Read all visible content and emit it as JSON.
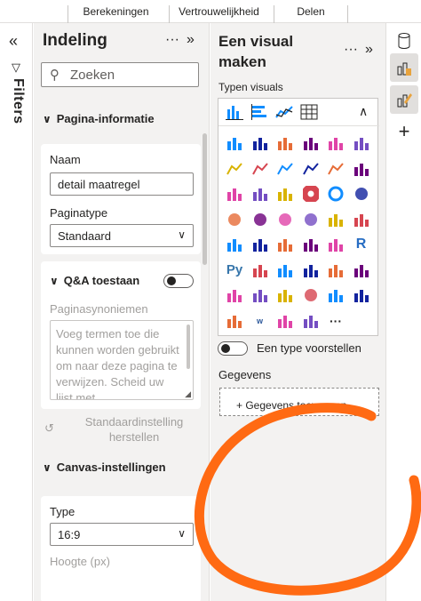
{
  "ribbon": {
    "tabs": [
      "Berekeningen",
      "Vertrouwelijkheid",
      "Delen"
    ]
  },
  "filters_pane": {
    "label": "Filters",
    "expand_icon": "chevron-double-left-icon",
    "filter_icon": "funnel-icon"
  },
  "format_pane": {
    "title": "Indeling",
    "more": "···",
    "search_placeholder": "Zoeken",
    "pagina_section": "Pagina-informatie",
    "name_label": "Naam",
    "name_value": "detail maatregel",
    "pagetype_label": "Paginatype",
    "pagetype_value": "Standaard",
    "qa_title": "Q&A toestaan",
    "synonyms_label": "Paginasynoniemen",
    "synonyms_placeholder": "Voeg termen toe die kunnen worden gebruikt om naar deze pagina te verwijzen. Scheid uw lijst met",
    "reset_label": "Standaardinstelling herstellen",
    "canvas_section": "Canvas-instellingen",
    "type_label": "Type",
    "type_value": "16:9",
    "height_label": "Hoogte (px)"
  },
  "viz_pane": {
    "title": "Een visual maken",
    "more": "···",
    "subtitle": "Typen visuals",
    "suggest_label": "Een type voorstellen",
    "data_label": "Gegevens",
    "add_data_label": "+ Gegevens toevoegen",
    "more_visuals": "···",
    "visual_icons": [
      "stacked-bar-chart-icon",
      "clustered-bar-chart-icon",
      "stacked-column-chart-icon",
      "clustered-column-chart-icon",
      "100-stacked-bar-icon",
      "100-stacked-column-icon",
      "line-chart-icon",
      "area-chart-icon",
      "stacked-area-chart-icon",
      "line-clustered-column-icon",
      "line-stacked-column-icon",
      "ribbon-chart-icon",
      "waterfall-chart-icon",
      "funnel-chart-icon",
      "scatter-chart-icon",
      "pie-chart-icon",
      "donut-chart-icon",
      "treemap-icon",
      "map-icon",
      "filled-map-icon",
      "shape-map-icon",
      "azure-map-icon",
      "gauge-icon",
      "card-icon",
      "multi-row-card-icon",
      "kpi-icon",
      "slicer-icon",
      "table-icon",
      "matrix-icon",
      "r-visual-icon",
      "python-visual-icon",
      "key-influencers-icon",
      "decomposition-tree-icon",
      "qa-visual-icon",
      "smart-narrative-icon",
      "trophy-goals-icon",
      "paginated-report-icon",
      "power-apps-icon",
      "power-automate-icon",
      "arcgis-map-icon",
      "diamond-visual-icon",
      "chevron-visual-icon",
      "custom-visual-1-icon",
      "word-visual-icon",
      "hierarchy-visual-icon",
      "custom-visual-2-icon",
      "more-visuals-icon"
    ]
  },
  "rail": {
    "buttons": [
      "cylinder-icon",
      "build-visual-icon",
      "format-visual-icon",
      "plus-icon"
    ]
  },
  "colors": {
    "accent_orange": "#ff6a13",
    "chart_blue": "#118dff",
    "pane_bg": "#f3f2f1"
  }
}
